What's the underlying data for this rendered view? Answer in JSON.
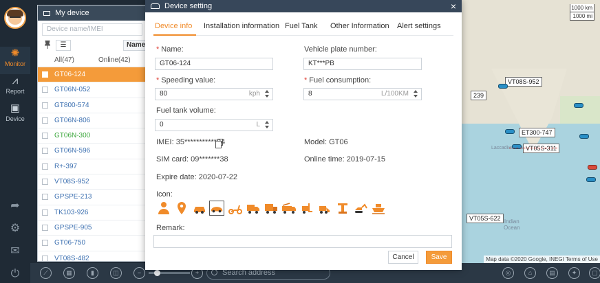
{
  "nav": {
    "items": [
      {
        "label": "Monitor",
        "icon": "palette-icon"
      },
      {
        "label": "Report",
        "icon": "chart-icon"
      },
      {
        "label": "Device",
        "icon": "device-icon"
      }
    ]
  },
  "panel": {
    "title": "My device",
    "search_placeholder": "Device name/IMEI",
    "name_button": "Name",
    "tab_all": "All(47)",
    "tab_online": "Online(42)",
    "devices": [
      {
        "name": "GT06-124"
      },
      {
        "name": "GT06N-052"
      },
      {
        "name": "GT800-574"
      },
      {
        "name": "GT06N-806"
      },
      {
        "name": "GT06N-300"
      },
      {
        "name": "GT06N-596"
      },
      {
        "name": "R+-397"
      },
      {
        "name": "VT08S-952"
      },
      {
        "name": "GPSPE-213"
      },
      {
        "name": "TK103-926"
      },
      {
        "name": "GPSPE-905"
      },
      {
        "name": "GT06-750"
      },
      {
        "name": "VT08S-482"
      }
    ]
  },
  "map": {
    "scale_km": "1000 km",
    "scale_mi": "1000 mi",
    "labels": {
      "sea": "Indian\nOcean",
      "lacca": "Laccadive Sea"
    },
    "vehicles": [
      "VT08S-952",
      "ET300-747",
      "VT05S-311",
      "VT05S-622",
      "239"
    ],
    "attribution": "Map data ©2020 Google, INEGI   Terms of Use"
  },
  "bottombar": {
    "search_placeholder": "Search address"
  },
  "modal": {
    "title": "Device setting",
    "close": "×",
    "tabs": [
      "Device info",
      "Installation information",
      "Fuel Tank",
      "Other Information",
      "Alert settings"
    ],
    "fields": {
      "name_label": "Name:",
      "name_value": "GT06-124",
      "plate_label": "Vehicle plate number:",
      "plate_value": "KT***PB",
      "speeding_label": "Speeding value:",
      "speeding_value": "80",
      "speeding_unit": "kph",
      "fuel_label": "Fuel consumption:",
      "fuel_value": "8",
      "fuel_unit": "L/100KM",
      "tank_label": "Fuel tank volume:",
      "tank_value": "0",
      "tank_unit": "L"
    },
    "info": {
      "imei": "IMEI: 35***********24",
      "model": "Model: GT06",
      "sim": "SIM card: 09*******38",
      "online_time": "Online time: 2019-07-15",
      "expire": "Expire date: 2020-07-22"
    },
    "icon_label": "Icon:",
    "icons": [
      "person-icon",
      "location-pin-icon",
      "car-icon",
      "sedan-icon",
      "scooter-icon",
      "truck-icon",
      "box-truck-icon",
      "fire-truck-icon",
      "forklift-icon",
      "loader-icon",
      "crane-icon",
      "excavator-icon",
      "ship-icon"
    ],
    "remark_label": "Remark:",
    "cancel_label": "Cancel",
    "save_label": "Save"
  },
  "colors": {
    "accent": "#f08b2a",
    "header": "#37475a",
    "required": "#e0433a"
  }
}
